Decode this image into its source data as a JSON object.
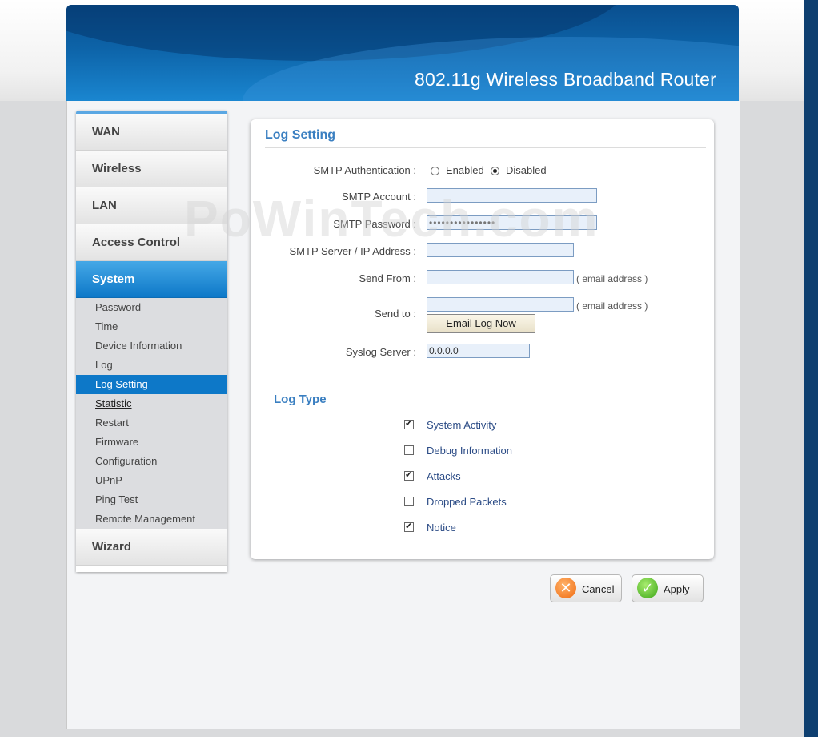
{
  "banner": {
    "title": "802.11g Wireless Broadband Router"
  },
  "sidebar": {
    "menu": [
      {
        "label": "WAN"
      },
      {
        "label": "Wireless"
      },
      {
        "label": "LAN"
      },
      {
        "label": "Access Control"
      },
      {
        "label": "System",
        "active": true
      }
    ],
    "system_submenu": [
      {
        "label": "Password"
      },
      {
        "label": "Time"
      },
      {
        "label": "Device Information"
      },
      {
        "label": "Log"
      },
      {
        "label": "Log Setting",
        "active": true
      },
      {
        "label": "Statistic",
        "hover": true
      },
      {
        "label": "Restart"
      },
      {
        "label": "Firmware"
      },
      {
        "label": "Configuration"
      },
      {
        "label": "UPnP"
      },
      {
        "label": "Ping Test"
      },
      {
        "label": "Remote Management"
      }
    ],
    "wizard": {
      "label": "Wizard"
    }
  },
  "log_setting": {
    "title": "Log Setting",
    "smtp_auth": {
      "label": "SMTP Authentication :",
      "enabled_label": "Enabled",
      "disabled_label": "Disabled",
      "selected": "Disabled"
    },
    "smtp_account": {
      "label": "SMTP Account :",
      "value": ""
    },
    "smtp_password": {
      "label": "SMTP Password :",
      "value": "••••••••••••••••"
    },
    "smtp_server": {
      "label": "SMTP Server / IP Address :",
      "value": ""
    },
    "send_from": {
      "label": "Send From :",
      "value": "",
      "hint": "( email address )"
    },
    "send_to": {
      "label": "Send to :",
      "value": "",
      "hint": "( email address )"
    },
    "email_log_button": "Email Log Now",
    "syslog_server": {
      "label": "Syslog Server :",
      "value": "0.0.0.0"
    }
  },
  "log_type": {
    "title": "Log Type",
    "items": [
      {
        "label": "System Activity",
        "checked": true
      },
      {
        "label": "Debug Information",
        "checked": false
      },
      {
        "label": "Attacks",
        "checked": true
      },
      {
        "label": "Dropped Packets",
        "checked": false
      },
      {
        "label": "Notice",
        "checked": true
      }
    ]
  },
  "actions": {
    "cancel_label": "Cancel",
    "apply_label": "Apply"
  },
  "watermark": "PoWinTech.com",
  "colors": {
    "accent": "#3a7fc1",
    "menu_active": "#0d78c8",
    "banner": "#0d63a8"
  }
}
